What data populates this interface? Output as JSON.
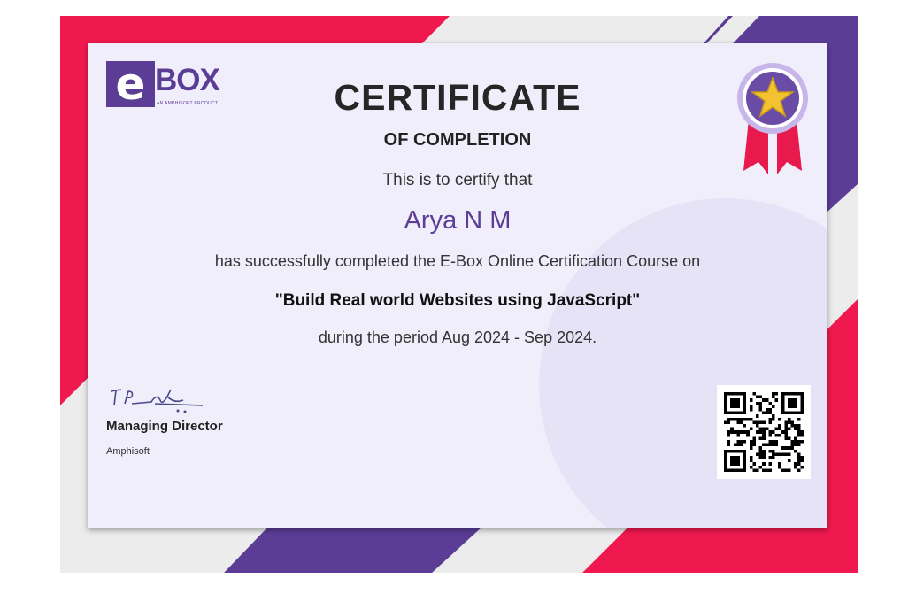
{
  "logo": {
    "mark": "e",
    "name": "BOX",
    "tagline": "AN AMPHISOFT PRODUCT"
  },
  "certificate": {
    "title": "CERTIFICATE",
    "subtitle": "OF COMPLETION",
    "intro": "This is to certify that",
    "recipient": "Arya N M",
    "statement": "has successfully completed the E-Box Online Certification Course on",
    "course": "\"Build Real world Websites using JavaScript\"",
    "period": "during the period Aug 2024 - Sep 2024."
  },
  "signatory": {
    "title": "Managing Director",
    "organization": "Amphisoft"
  },
  "icons": {
    "medal": "star-medal-icon",
    "qr": "qr-code-icon",
    "signature": "signature-icon"
  },
  "colors": {
    "brand_purple": "#5b3d96",
    "accent_pink": "#f0194f",
    "card": "#f0eefb",
    "gold": "#f2c230"
  }
}
